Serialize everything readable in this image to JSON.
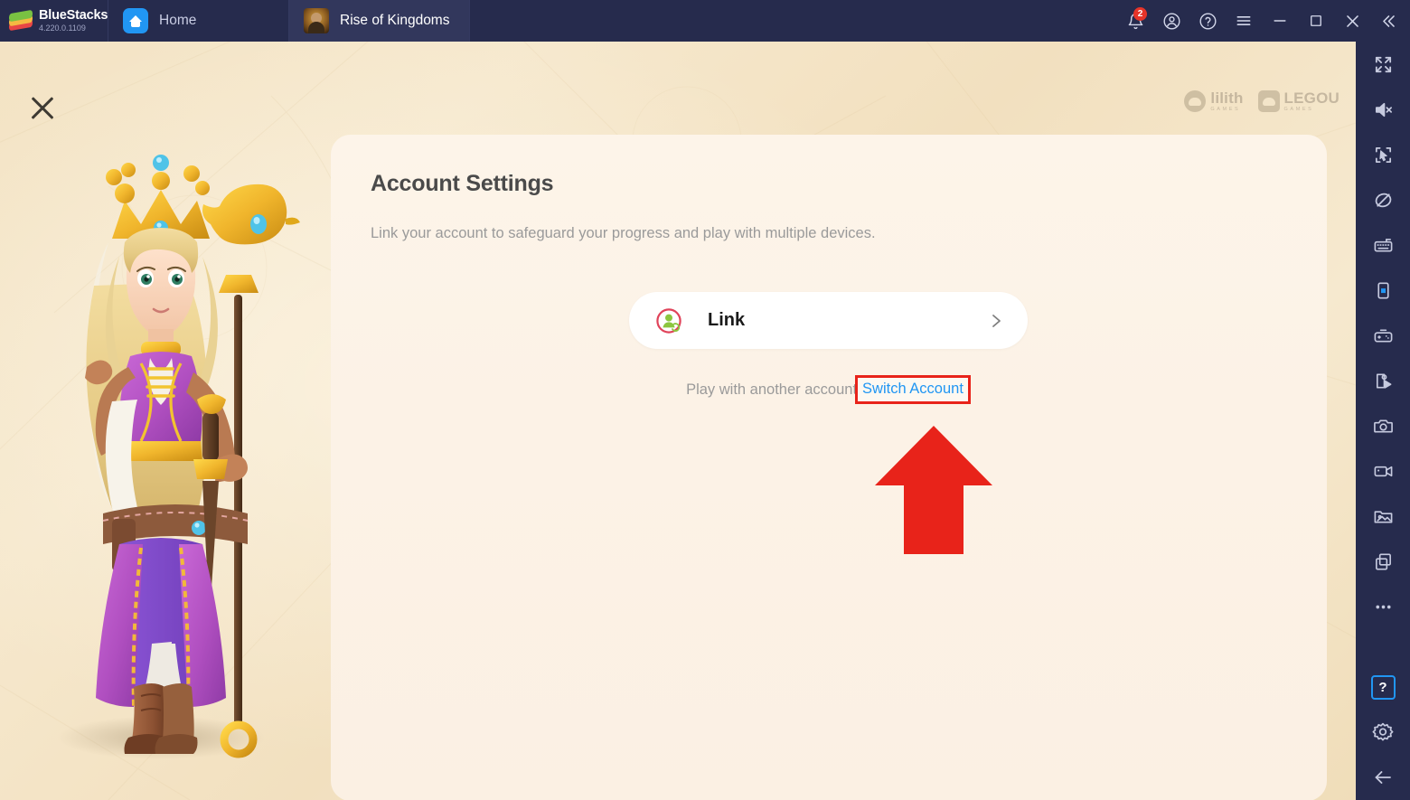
{
  "titlebar": {
    "brand_name": "BlueStacks",
    "version": "4.220.0.1109",
    "tabs": [
      {
        "label": "Home",
        "icon": "home-icon",
        "active": false
      },
      {
        "label": "Rise of Kingdoms",
        "icon": "game-icon",
        "active": true
      }
    ],
    "controls": [
      {
        "name": "notifications-button",
        "icon": "bell-icon",
        "badge": "2"
      },
      {
        "name": "account-button",
        "icon": "user-circle-icon"
      },
      {
        "name": "help-button",
        "icon": "question-circle-icon"
      },
      {
        "name": "menu-button",
        "icon": "hamburger-icon"
      },
      {
        "name": "minimize-button",
        "icon": "minimize-icon"
      },
      {
        "name": "maximize-button",
        "icon": "maximize-icon"
      },
      {
        "name": "close-button",
        "icon": "close-icon"
      },
      {
        "name": "collapse-sidebar-button",
        "icon": "double-chevron-left-icon"
      }
    ]
  },
  "game": {
    "close_icon": "close-x-icon",
    "publishers": [
      {
        "name": "lilith",
        "sub": "GAMES"
      },
      {
        "name": "LEGOU",
        "sub": "GAMES"
      }
    ],
    "character_alt": "queen-character-art"
  },
  "panel": {
    "title": "Account Settings",
    "subtitle": "Link your account to safeguard your progress and play with multiple devices.",
    "link_button": {
      "label": "Link",
      "icon": "account-link-icon",
      "chevron": "chevron-right-icon"
    },
    "switch": {
      "prefix": "Play with another account",
      "link_label": "Switch Account"
    }
  },
  "annotations": {
    "highlight_color": "#e8231a",
    "arrow_color": "#e8231a",
    "arrow_direction": "up",
    "target": "Switch Account"
  },
  "sidebar": {
    "items": [
      {
        "name": "fullscreen-button",
        "icon": "fullscreen-icon"
      },
      {
        "name": "mute-button",
        "icon": "speaker-mute-icon"
      },
      {
        "name": "shooting-mode-button",
        "icon": "crosshair-cursor-icon"
      },
      {
        "name": "eco-mode-button",
        "icon": "circle-slash-icon"
      },
      {
        "name": "keymapping-button",
        "icon": "keyboard-icon"
      },
      {
        "name": "rotate-button",
        "icon": "phone-rotate-icon"
      },
      {
        "name": "gamepad-button",
        "icon": "gamepad-icon"
      },
      {
        "name": "macro-button",
        "icon": "script-play-icon"
      },
      {
        "name": "screenshot-button",
        "icon": "camera-icon"
      },
      {
        "name": "record-button",
        "icon": "video-camera-icon"
      },
      {
        "name": "media-manager-button",
        "icon": "image-folder-icon"
      },
      {
        "name": "multi-instance-button",
        "icon": "copy-windows-icon"
      },
      {
        "name": "more-button",
        "icon": "ellipsis-icon"
      }
    ],
    "bottom_items": [
      {
        "name": "help-button",
        "icon": "question-box-icon",
        "label": "?",
        "highlighted": true
      },
      {
        "name": "settings-button",
        "icon": "gear-icon"
      },
      {
        "name": "back-button",
        "icon": "arrow-left-icon"
      }
    ]
  }
}
